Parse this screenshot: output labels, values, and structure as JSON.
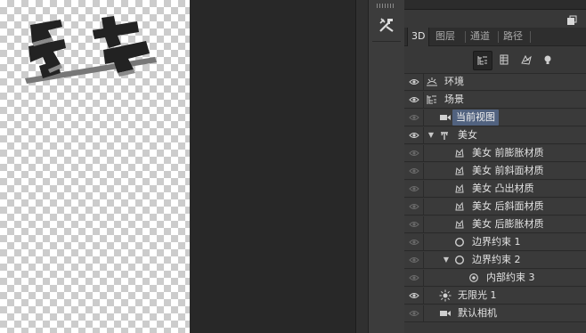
{
  "colors": {
    "panel_bg": "#383838",
    "selected": "#51627f",
    "workspace": "#282828"
  },
  "tool": {
    "icon": "tools-icon"
  },
  "panel": {
    "menu_icon": "panel-menu-icon",
    "tabs": [
      {
        "label": "3D",
        "active": true
      },
      {
        "label": "图层",
        "active": false
      },
      {
        "label": "通道",
        "active": false
      },
      {
        "label": "路径",
        "active": false
      }
    ],
    "filter_icons": [
      "scene-filter-icon",
      "mesh-filter-icon",
      "material-filter-icon",
      "light-filter-icon"
    ],
    "layers": [
      {
        "label": "环境",
        "icon": "environment-icon",
        "visible": true,
        "indent": 0
      },
      {
        "label": "场景",
        "icon": "scene-icon",
        "visible": true,
        "indent": 0
      },
      {
        "label": "当前视图",
        "icon": "camera-icon",
        "visible": false,
        "indent": 1,
        "selected": true
      },
      {
        "label": "美女",
        "icon": "mesh-icon",
        "visible": true,
        "indent": 0,
        "expanded": true
      },
      {
        "label": "美女 前膨胀材质",
        "icon": "material-icon",
        "visible": false,
        "indent": 2
      },
      {
        "label": "美女 前斜面材质",
        "icon": "material-icon",
        "visible": false,
        "indent": 2
      },
      {
        "label": "美女 凸出材质",
        "icon": "material-icon",
        "visible": false,
        "indent": 2
      },
      {
        "label": "美女 后斜面材质",
        "icon": "material-icon",
        "visible": false,
        "indent": 2
      },
      {
        "label": "美女 后膨胀材质",
        "icon": "material-icon",
        "visible": false,
        "indent": 2
      },
      {
        "label": "边界约束 1",
        "icon": "constraint-icon",
        "visible": false,
        "indent": 2
      },
      {
        "label": "边界约束 2",
        "icon": "constraint-icon",
        "visible": false,
        "indent": 1,
        "expanded": true
      },
      {
        "label": "内部约束 3",
        "icon": "inner-constraint-icon",
        "visible": false,
        "indent": 3
      },
      {
        "label": "无限光 1",
        "icon": "infinite-light-icon",
        "visible": true,
        "indent": 0
      },
      {
        "label": "默认相机",
        "icon": "camera-icon",
        "visible": false,
        "indent": 1
      }
    ]
  }
}
